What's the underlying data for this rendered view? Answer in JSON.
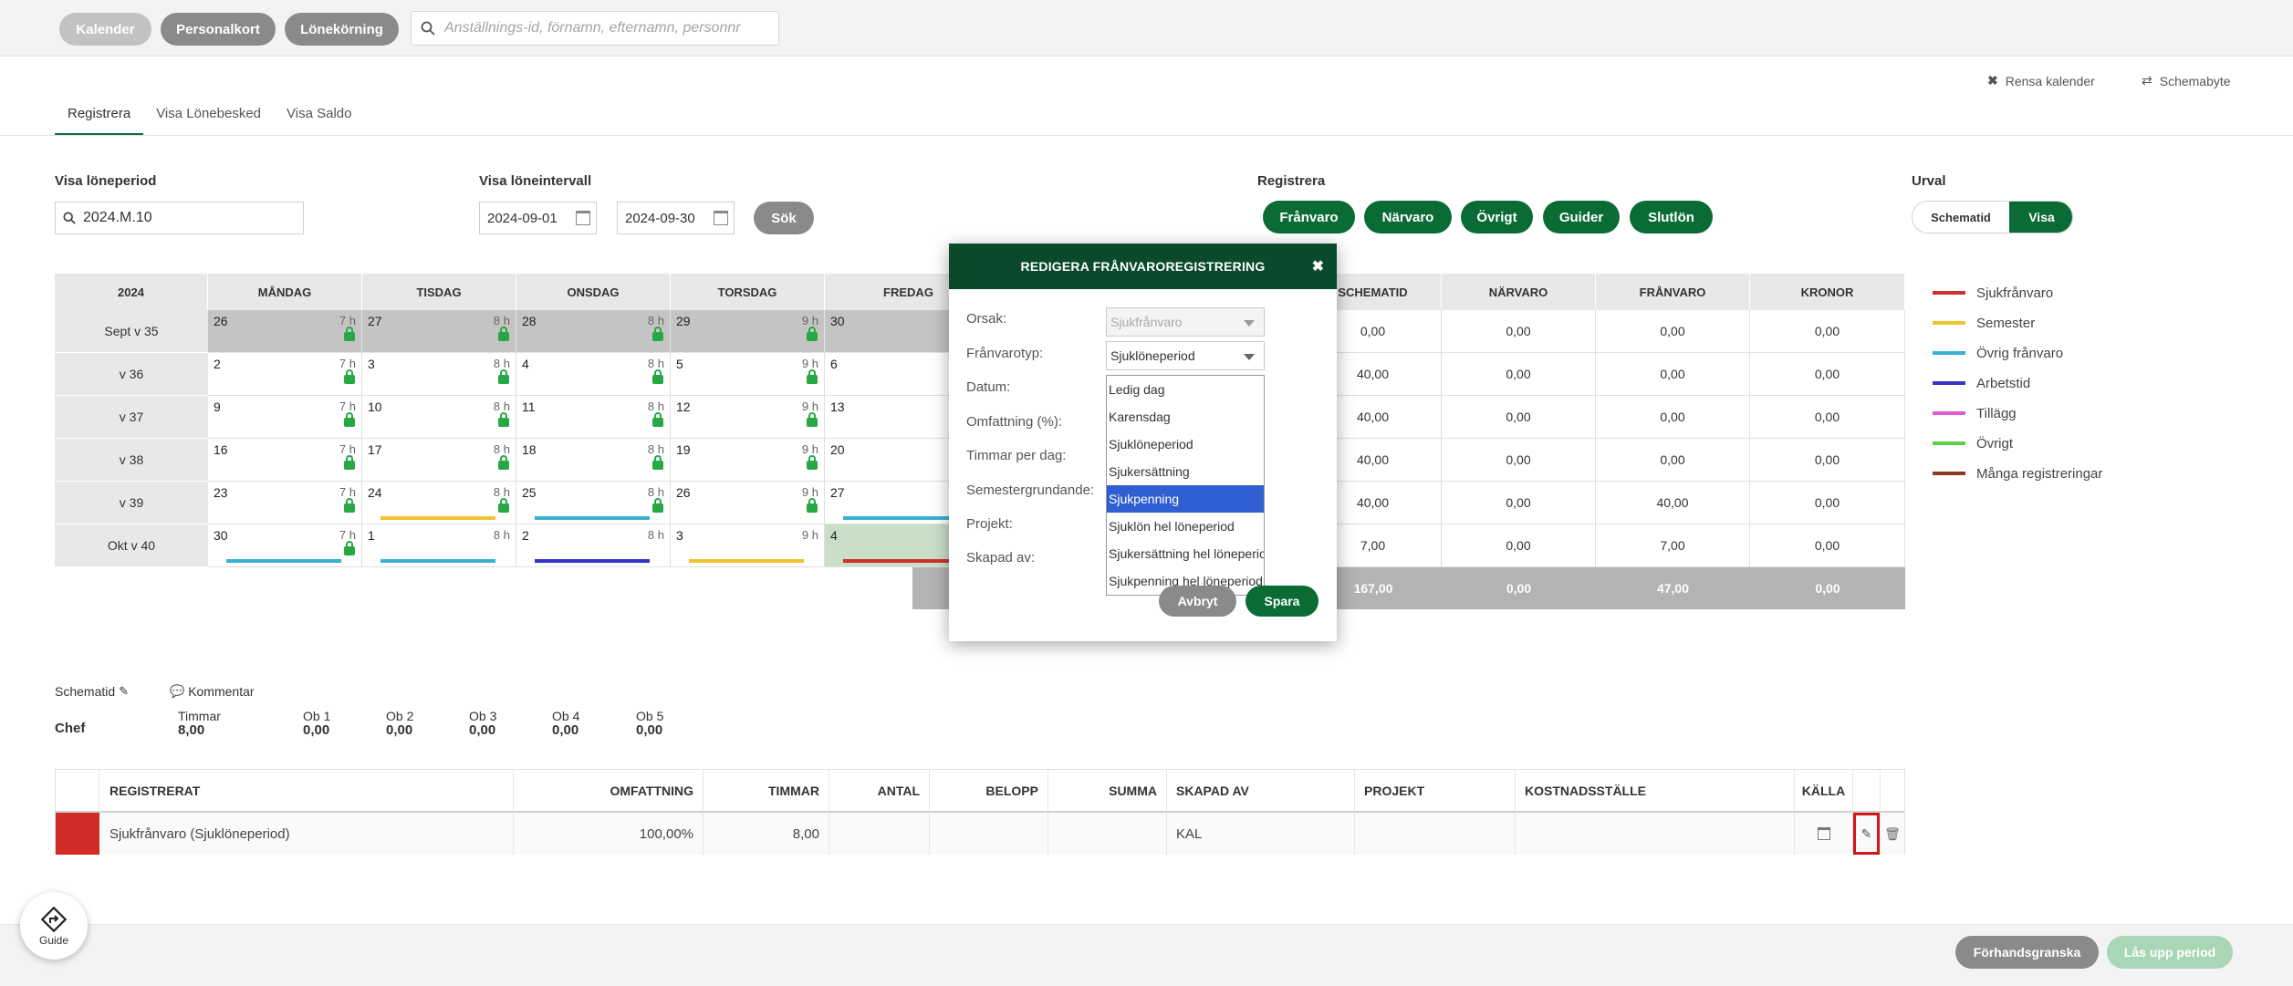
{
  "topbar": {
    "buttons": [
      "Kalender",
      "Personalkort",
      "Lönekörning"
    ],
    "search_placeholder": "Anställnings-id, förnamn, efternamn, personnr"
  },
  "actions": {
    "clear": "Rensa kalender",
    "swap": "Schemabyte"
  },
  "tabs": [
    "Registrera",
    "Visa Lönebesked",
    "Visa Saldo"
  ],
  "period": {
    "label": "Visa löneperiod",
    "value": "2024.M.10"
  },
  "interval": {
    "label": "Visa löneintervall",
    "from": "2024-09-01",
    "to": "2024-09-30",
    "search": "Sök"
  },
  "registrera": {
    "label": "Registrera",
    "buttons": [
      "Frånvaro",
      "Närvaro",
      "Övrigt",
      "Guider",
      "Slutlön"
    ]
  },
  "urval": {
    "label": "Urval",
    "left": "Schematid",
    "right": "Visa"
  },
  "calendar": {
    "year": "2024",
    "days": [
      "MÅNDAG",
      "TISDAG",
      "ONSDAG",
      "TORSDAG",
      "FREDAG"
    ],
    "weeks": [
      "Sept v 35",
      "v 36",
      "v 37",
      "v 38",
      "v 39",
      "Okt v 40"
    ],
    "dates": [
      [
        "26",
        "27",
        "28",
        "29",
        "30"
      ],
      [
        "2",
        "3",
        "4",
        "5",
        "6"
      ],
      [
        "9",
        "10",
        "11",
        "12",
        "13"
      ],
      [
        "16",
        "17",
        "18",
        "19",
        "20"
      ],
      [
        "23",
        "24",
        "25",
        "26",
        "27"
      ],
      [
        "30",
        "1",
        "2",
        "3",
        "4"
      ]
    ],
    "hours": [
      [
        "7 h",
        "8 h",
        "8 h",
        "9 h",
        ""
      ],
      [
        "7 h",
        "8 h",
        "8 h",
        "9 h",
        ""
      ],
      [
        "7 h",
        "8 h",
        "8 h",
        "9 h",
        ""
      ],
      [
        "7 h",
        "8 h",
        "8 h",
        "9 h",
        ""
      ],
      [
        "7 h",
        "8 h",
        "8 h",
        "9 h",
        ""
      ],
      [
        "7 h",
        "8 h",
        "8 h",
        "9 h",
        ""
      ]
    ]
  },
  "summary": {
    "headers": [
      "SCHEMATID",
      "NÄRVARO",
      "FRÅNVARO",
      "KRONOR"
    ],
    "rows": [
      [
        "0,00",
        "0,00",
        "0,00",
        "0,00"
      ],
      [
        "40,00",
        "0,00",
        "0,00",
        "0,00"
      ],
      [
        "40,00",
        "0,00",
        "0,00",
        "0,00"
      ],
      [
        "40,00",
        "0,00",
        "0,00",
        "0,00"
      ],
      [
        "40,00",
        "0,00",
        "40,00",
        "0,00"
      ],
      [
        "7,00",
        "0,00",
        "7,00",
        "0,00"
      ]
    ],
    "totals": [
      "167,00",
      "0,00",
      "47,00",
      "0,00"
    ]
  },
  "legend": [
    {
      "label": "Sjukfrånvaro",
      "color": "#d0312d"
    },
    {
      "label": "Semester",
      "color": "#f0c330"
    },
    {
      "label": "Övrig frånvaro",
      "color": "#39b1d3"
    },
    {
      "label": "Arbetstid",
      "color": "#3533c8"
    },
    {
      "label": "Tillägg",
      "color": "#e05ad3"
    },
    {
      "label": "Övrigt",
      "color": "#5bd048"
    },
    {
      "label": "Många registreringar",
      "color": "#8b3a1f"
    }
  ],
  "bottom": {
    "schematid": "Schematid",
    "kommentar": "Kommentar",
    "role": "Chef",
    "stats": [
      {
        "label": "Timmar",
        "value": "8,00"
      },
      {
        "label": "Ob 1",
        "value": "0,00"
      },
      {
        "label": "Ob 2",
        "value": "0,00"
      },
      {
        "label": "Ob 3",
        "value": "0,00"
      },
      {
        "label": "Ob 4",
        "value": "0,00"
      },
      {
        "label": "Ob 5",
        "value": "0,00"
      }
    ],
    "table": {
      "headers": [
        "REGISTRERAT",
        "OMFATTNING",
        "TIMMAR",
        "ANTAL",
        "BELOPP",
        "SUMMA",
        "SKAPAD AV",
        "PROJEKT",
        "KOSTNADSSTÄLLE",
        "KÄLLA"
      ],
      "row": [
        "Sjukfrånvaro (Sjuklöneperiod)",
        "100,00%",
        "8,00",
        "",
        "",
        "",
        "KAL",
        "",
        "",
        ""
      ]
    }
  },
  "footer": {
    "preview": "Förhandsgranska",
    "unlock": "Lås upp period",
    "guide": "Guide"
  },
  "modal": {
    "title": "REDIGERA FRÅNVAROREGISTRERING",
    "labels": [
      "Orsak:",
      "Frånvarotyp:",
      "Datum:",
      "Omfattning (%):",
      "Timmar per dag:",
      "Semestergrundande:",
      "Projekt:",
      "Skapad av:"
    ],
    "orsak": "Sjukfrånvaro",
    "franvarotyp": "Sjuklöneperiod",
    "options": [
      "Ledig dag",
      "Karensdag",
      "Sjuklöneperiod",
      "Sjukersättning",
      "Sjukpenning",
      "Sjuklön hel löneperiod",
      "Sjukersättning hel löneperiod",
      "Sjukpenning hel löneperiod"
    ],
    "selected_option": "Sjukpenning",
    "cancel": "Avbryt",
    "save": "Spara"
  }
}
